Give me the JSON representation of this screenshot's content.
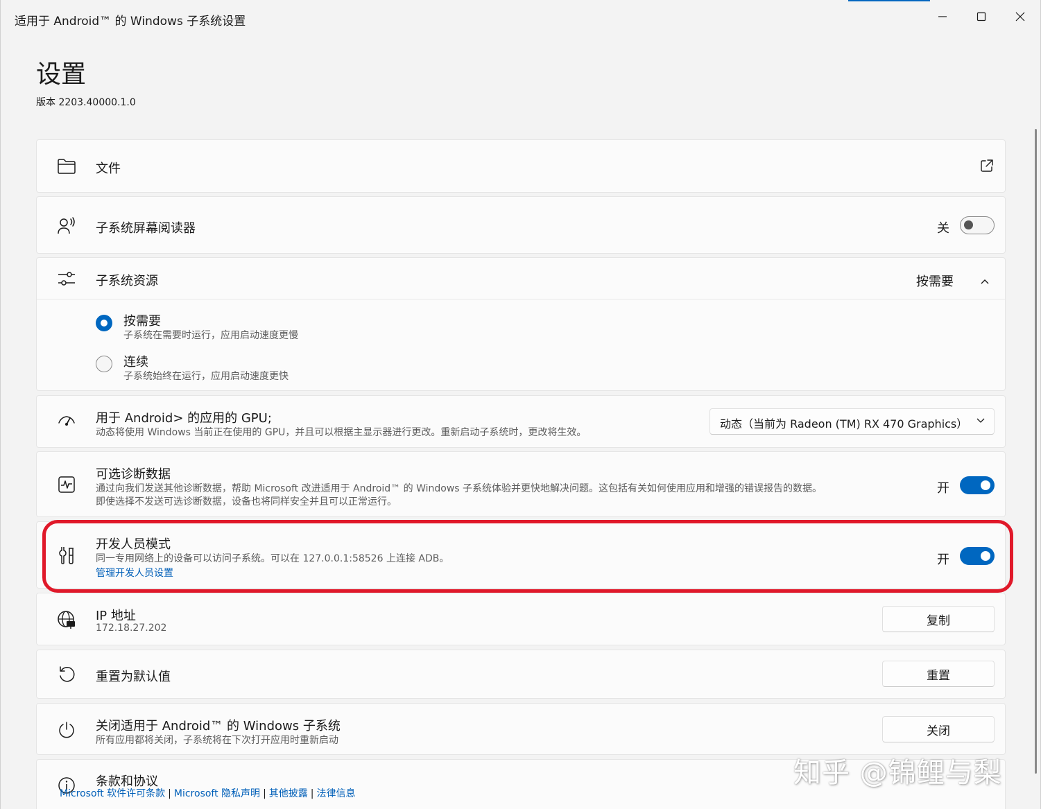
{
  "window": {
    "title": "适用于 Android™ 的 Windows 子系统设置"
  },
  "header": {
    "title": "设置",
    "version": "版本 2203.40000.1.0"
  },
  "cards": {
    "files": {
      "label": "文件"
    },
    "screen_reader": {
      "label": "子系统屏幕阅读器",
      "state": "关",
      "on": false
    },
    "resources": {
      "label": "子系统资源",
      "selected": "按需要",
      "options": [
        {
          "label": "按需要",
          "desc": "子系统在需要时运行，应用启动速度更慢",
          "selected": true
        },
        {
          "label": "连续",
          "desc": "子系统始终在运行，应用启动速度更快",
          "selected": false
        }
      ]
    },
    "gpu": {
      "label": "用于 Android> 的应用的 GPU;",
      "desc": "动态将使用 Windows 当前正在使用的 GPU，并且可以根据主显示器进行更改。重新启动子系统时，更改将生效。",
      "dropdown_value": "动态（当前为 Radeon (TM) RX 470 Graphics）"
    },
    "diagnostics": {
      "label": "可选诊断数据",
      "desc_line1": "通过向我们发送其他诊断数据，帮助 Microsoft 改进适用于 Android™ 的 Windows 子系统体验并更快地解决问题。这包括有关如何使用应用和增强的错误报告的数据。",
      "desc_line2": "即使选择不发送可选诊断数据，设备也将同样安全并且可以正常运行。",
      "state": "开",
      "on": true
    },
    "developer": {
      "label": "开发人员模式",
      "desc": "同一专用网络上的设备可以访问子系统。可以在 127.0.0.1:58526 上连接 ADB。",
      "link": "管理开发人员设置",
      "state": "开",
      "on": true
    },
    "ip": {
      "label": "IP 地址",
      "value": "172.18.27.202",
      "button": "复制"
    },
    "reset": {
      "label": "重置为默认值",
      "button": "重置"
    },
    "shutdown": {
      "label": "关闭适用于 Android™ 的 Windows 子系统",
      "desc": "所有应用都将关闭，子系统将在下次打开应用时重新启动",
      "button": "关闭"
    },
    "terms": {
      "label": "条款和协议",
      "links": [
        "Microsoft 软件许可条款",
        "Microsoft 隐私声明",
        "其他披露",
        "法律信息"
      ],
      "separator": "|"
    }
  },
  "watermark": "知乎 @锦鲤与梨",
  "colors": {
    "accent": "#0067c0",
    "link": "#005fb8",
    "highlight": "#e0192a"
  }
}
